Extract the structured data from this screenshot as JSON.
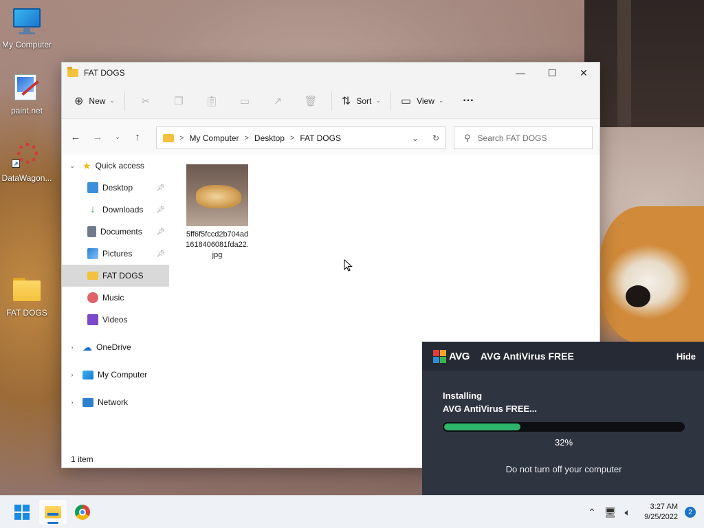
{
  "desktop": {
    "icons": [
      {
        "label": "My Computer"
      },
      {
        "label": "paint.net"
      },
      {
        "label": "DataWagon..."
      },
      {
        "label": "FAT DOGS"
      }
    ]
  },
  "explorer": {
    "title": "FAT DOGS",
    "controls": {
      "minimize": "—",
      "maximize": "☐",
      "close": "✕"
    },
    "toolbar": {
      "new_label": "New",
      "sort_label": "Sort",
      "view_label": "View",
      "more_label": "···"
    },
    "address": {
      "crumbs": [
        "My Computer",
        "Desktop",
        "FAT DOGS"
      ],
      "sep": ">"
    },
    "search": {
      "placeholder": "Search FAT DOGS"
    },
    "nav": {
      "quick_access": "Quick access",
      "items": [
        {
          "label": "Desktop",
          "color": "#3c8fd8"
        },
        {
          "label": "Downloads",
          "color": "#2e9a5b"
        },
        {
          "label": "Documents",
          "color": "#6f7b8a"
        },
        {
          "label": "Pictures",
          "color": "#2d7fd0"
        },
        {
          "label": "FAT DOGS",
          "color": "#f2c13d"
        },
        {
          "label": "Music",
          "color": "#e0626a"
        },
        {
          "label": "Videos",
          "color": "#7a4ac9"
        }
      ],
      "onedrive": "OneDrive",
      "mycomputer": "My Computer",
      "network": "Network"
    },
    "files": [
      {
        "name": "5ff6f5fccd2b704ad1618406081fda22.jpg"
      }
    ],
    "status": "1 item"
  },
  "avg": {
    "brand": "AVG",
    "title": "AVG AntiVirus FREE",
    "hide_label": "Hide",
    "line1": "Installing",
    "line2": "AVG AntiVirus FREE...",
    "progress": 0.32,
    "progress_text": "32%",
    "warning": "Do not turn off your computer",
    "accent": "#2fb56a"
  },
  "taskbar": {
    "time": "3:27 AM",
    "date": "9/25/2022",
    "notifications": "2"
  }
}
